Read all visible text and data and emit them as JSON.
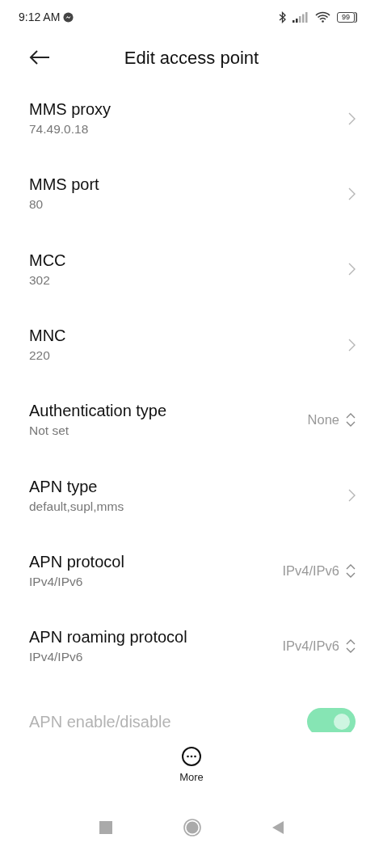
{
  "status_bar": {
    "time": "9:12 AM",
    "battery": "99"
  },
  "header": {
    "title": "Edit access point"
  },
  "settings": [
    {
      "kind": "link",
      "title": "MMS proxy",
      "subtitle": "74.49.0.18",
      "disabled": false
    },
    {
      "kind": "link",
      "title": "MMS port",
      "subtitle": "80",
      "disabled": false
    },
    {
      "kind": "link",
      "title": "MCC",
      "subtitle": "302",
      "disabled": false
    },
    {
      "kind": "link",
      "title": "MNC",
      "subtitle": "220",
      "disabled": false
    },
    {
      "kind": "select",
      "title": "Authentication type",
      "subtitle": "Not set",
      "value": "None",
      "disabled": false
    },
    {
      "kind": "link",
      "title": "APN type",
      "subtitle": "default,supl,mms",
      "disabled": false
    },
    {
      "kind": "select",
      "title": "APN protocol",
      "subtitle": "IPv4/IPv6",
      "value": "IPv4/IPv6",
      "disabled": false
    },
    {
      "kind": "select",
      "title": "APN roaming protocol",
      "subtitle": "IPv4/IPv6",
      "value": "IPv4/IPv6",
      "disabled": false
    },
    {
      "kind": "toggle",
      "title": "APN enable/disable",
      "on": true,
      "disabled": true
    }
  ],
  "bottom_action": {
    "label": "More"
  }
}
